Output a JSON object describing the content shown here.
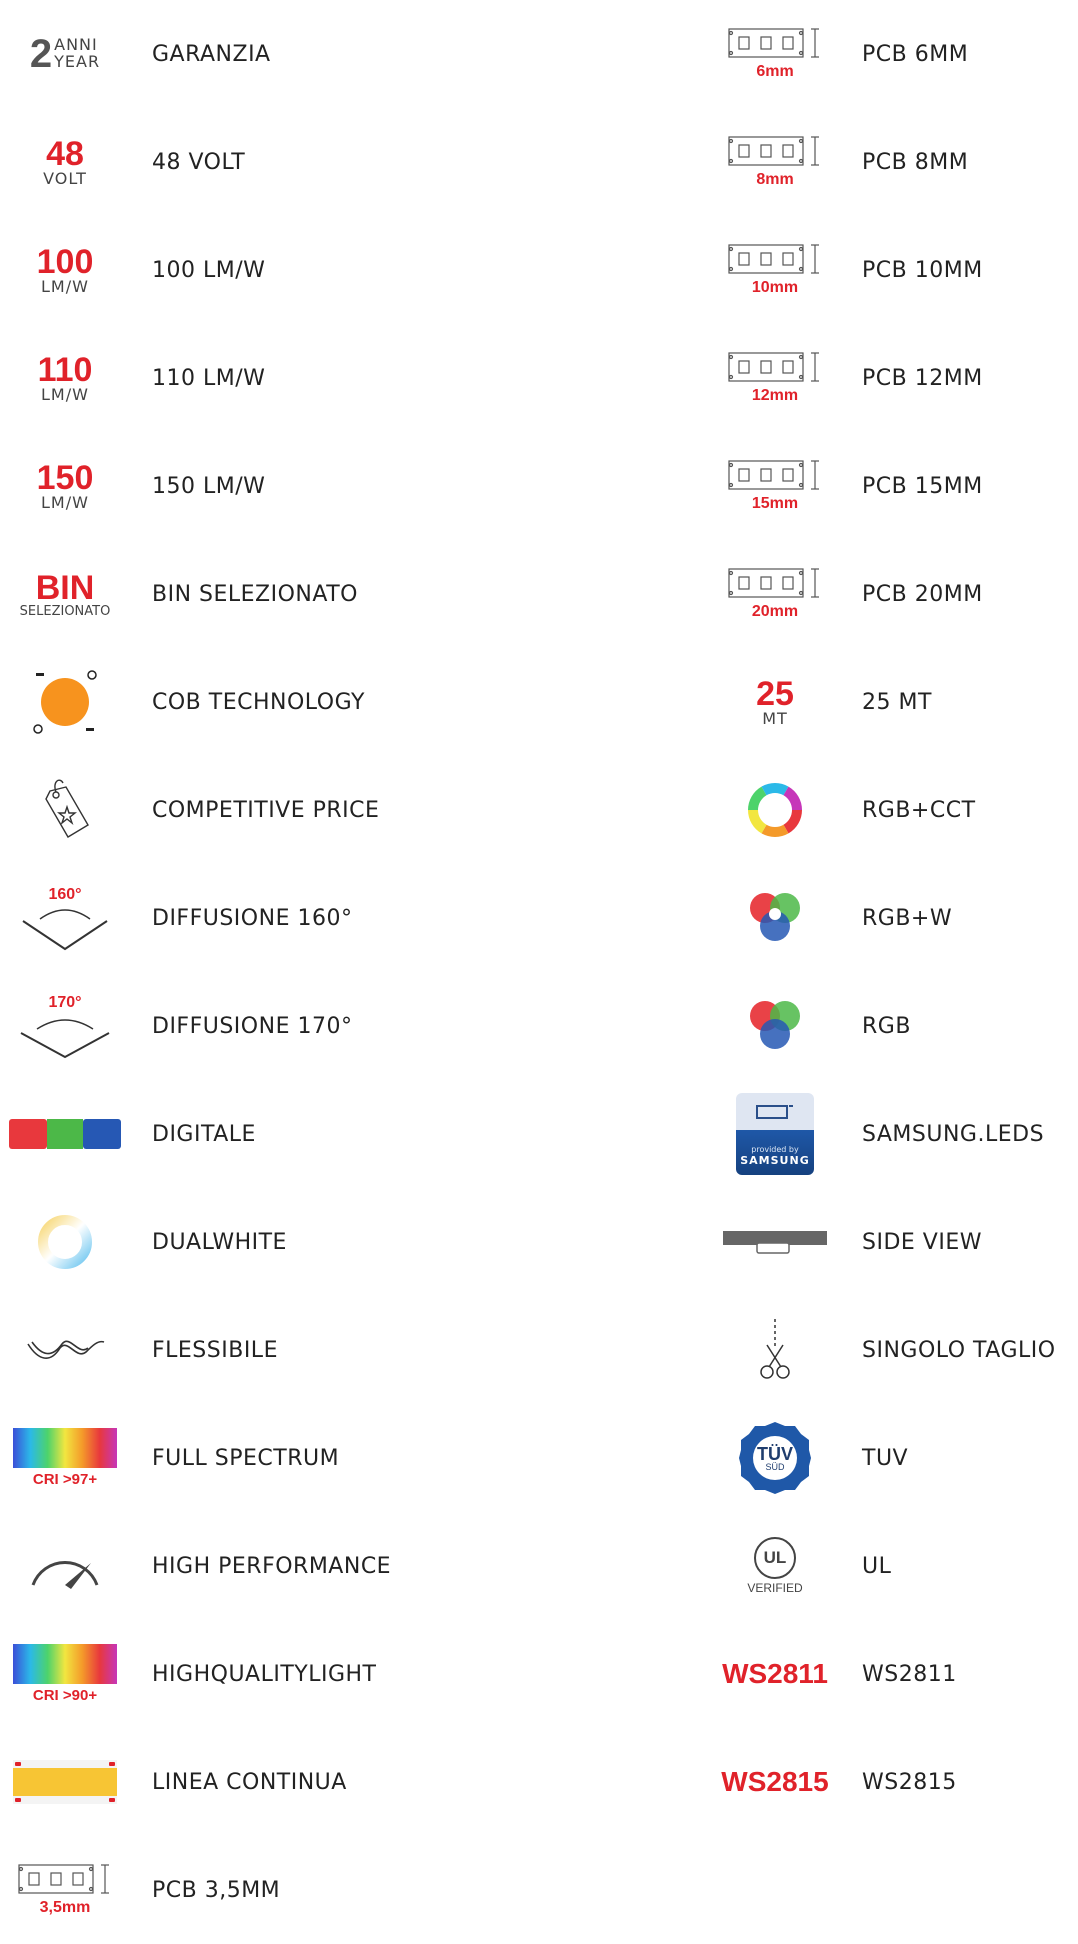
{
  "left": [
    {
      "icon": "warranty-2-years-icon",
      "icon_big": "2",
      "icon_top": "ANNI",
      "icon_bottom": "YEAR",
      "label": "GARANZIA"
    },
    {
      "icon": "voltage-48-icon",
      "icon_big": "48",
      "icon_small": "VOLT",
      "label": "48 VOLT"
    },
    {
      "icon": "efficacy-100-icon",
      "icon_big": "100",
      "icon_small": "LM/W",
      "label": "100 LM/W"
    },
    {
      "icon": "efficacy-110-icon",
      "icon_big": "110",
      "icon_small": "LM/W",
      "label": "110 LM/W"
    },
    {
      "icon": "efficacy-150-icon",
      "icon_big": "150",
      "icon_small": "LM/W",
      "label": "150 LM/W"
    },
    {
      "icon": "bin-selected-icon",
      "icon_big": "BIN",
      "icon_small": "SELEZIONATO",
      "label": "BIN SELEZIONATO"
    },
    {
      "icon": "cob-technology-icon",
      "label": "COB TECHNOLOGY"
    },
    {
      "icon": "price-tag-icon",
      "label": "COMPETITIVE PRICE"
    },
    {
      "icon": "beam-angle-160-icon",
      "icon_text": "160°",
      "label": "DIFFUSIONE 160°"
    },
    {
      "icon": "beam-angle-170-icon",
      "icon_text": "170°",
      "label": "DIFFUSIONE 170°"
    },
    {
      "icon": "digital-rgb-bar-icon",
      "label": "DIGITALE"
    },
    {
      "icon": "dualwhite-ring-icon",
      "label": "DUALWHITE"
    },
    {
      "icon": "flexible-ribbon-icon",
      "label": "FLESSIBILE"
    },
    {
      "icon": "full-spectrum-icon",
      "icon_text": "CRI >97+",
      "label": "FULL SPECTRUM"
    },
    {
      "icon": "speedometer-icon",
      "label": "HIGH PERFORMANCE"
    },
    {
      "icon": "high-quality-light-icon",
      "icon_text": "CRI >90+",
      "label": "HIGHQUALITYLIGHT"
    },
    {
      "icon": "continuous-line-icon",
      "label": "LINEA CONTINUA"
    },
    {
      "icon": "pcb-strip-icon",
      "icon_text": "3,5mm",
      "label": "PCB 3,5MM"
    }
  ],
  "right": [
    {
      "icon": "pcb-strip-icon",
      "icon_text": "6mm",
      "label": "PCB 6MM"
    },
    {
      "icon": "pcb-strip-icon",
      "icon_text": "8mm",
      "label": "PCB 8MM"
    },
    {
      "icon": "pcb-strip-icon",
      "icon_text": "10mm",
      "label": "PCB 10MM"
    },
    {
      "icon": "pcb-strip-icon",
      "icon_text": "12mm",
      "label": "PCB 12MM"
    },
    {
      "icon": "pcb-strip-icon",
      "icon_text": "15mm",
      "label": "PCB 15MM"
    },
    {
      "icon": "pcb-strip-icon",
      "icon_text": "20mm",
      "label": "PCB 20MM"
    },
    {
      "icon": "length-25m-icon",
      "icon_big": "25",
      "icon_small": "MT",
      "label": "25 MT"
    },
    {
      "icon": "rgb-cct-ring-icon",
      "label": "RGB+CCT"
    },
    {
      "icon": "rgbw-circles-icon",
      "label": "RGB+W"
    },
    {
      "icon": "rgb-circles-icon",
      "label": "RGB"
    },
    {
      "icon": "samsung-leds-badge-icon",
      "icon_text": "provided by",
      "icon_text2": "SAMSUNG",
      "label": "SAMSUNG.LEDS"
    },
    {
      "icon": "side-view-icon",
      "label": "SIDE VIEW"
    },
    {
      "icon": "scissors-cut-icon",
      "label": "SINGOLO TAGLIO"
    },
    {
      "icon": "tuv-seal-icon",
      "icon_text": "TÜV",
      "icon_text2": "SÜD",
      "label": "TUV"
    },
    {
      "icon": "ul-verified-icon",
      "icon_text": "UL",
      "icon_text2": "VERIFIED",
      "label": "UL"
    },
    {
      "icon": "ws2811-text-icon",
      "icon_text": "WS2811",
      "label": "WS2811"
    },
    {
      "icon": "ws2815-text-icon",
      "icon_text": "WS2815",
      "label": "WS2815"
    }
  ],
  "colors": {
    "accent": "#e0222a",
    "text": "#222222",
    "cob_orange": "#f7931e"
  }
}
